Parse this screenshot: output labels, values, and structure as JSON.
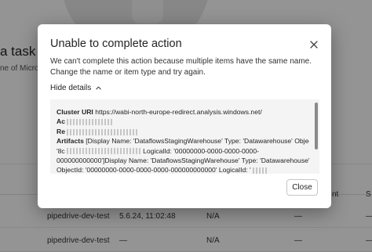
{
  "background": {
    "heading": "a task f",
    "subtext": "ne of Micro",
    "columns": [
      "nt",
      "S"
    ],
    "rows": [
      {
        "name": "pipedrive-dev-test",
        "version": "5.6.24, 11:02:48",
        "value": "N/A",
        "dash": "—"
      },
      {
        "name": "pipedrive-dev-test",
        "version": "—",
        "value": "N/A",
        "dash": "—"
      }
    ]
  },
  "dialog": {
    "title": "Unable to complete action",
    "message": "We can't complete this action because multiple items have the same name. Change the name or item type and try again.",
    "toggle_label": "Hide details",
    "details": {
      "cluster_label": "Cluster URI",
      "cluster_value": "https://wabi-north-europe-redirect.analysis.windows.net/",
      "activity_label": "Ac",
      "request_label": "Re",
      "artifacts_label": "Artifacts",
      "artifacts_line1": "[Display Name: 'DataflowsStagingWarehouse' Type: 'Datawarehouse' ObjectId:",
      "artifacts_line2a": "'8c",
      "artifacts_line2b": "LogicalId: '00000000-0000-0000-0000-",
      "artifacts_line3": "000000000000']Display Name: 'DataflowsStagingWarehouse' Type: 'Datawarehouse'",
      "artifacts_line4a": "ObjectId: '00000000-0000-0000-0000-000000000000' LogicalId: '",
      "artifacts_line4b": ""
    },
    "close_label": "Close"
  }
}
